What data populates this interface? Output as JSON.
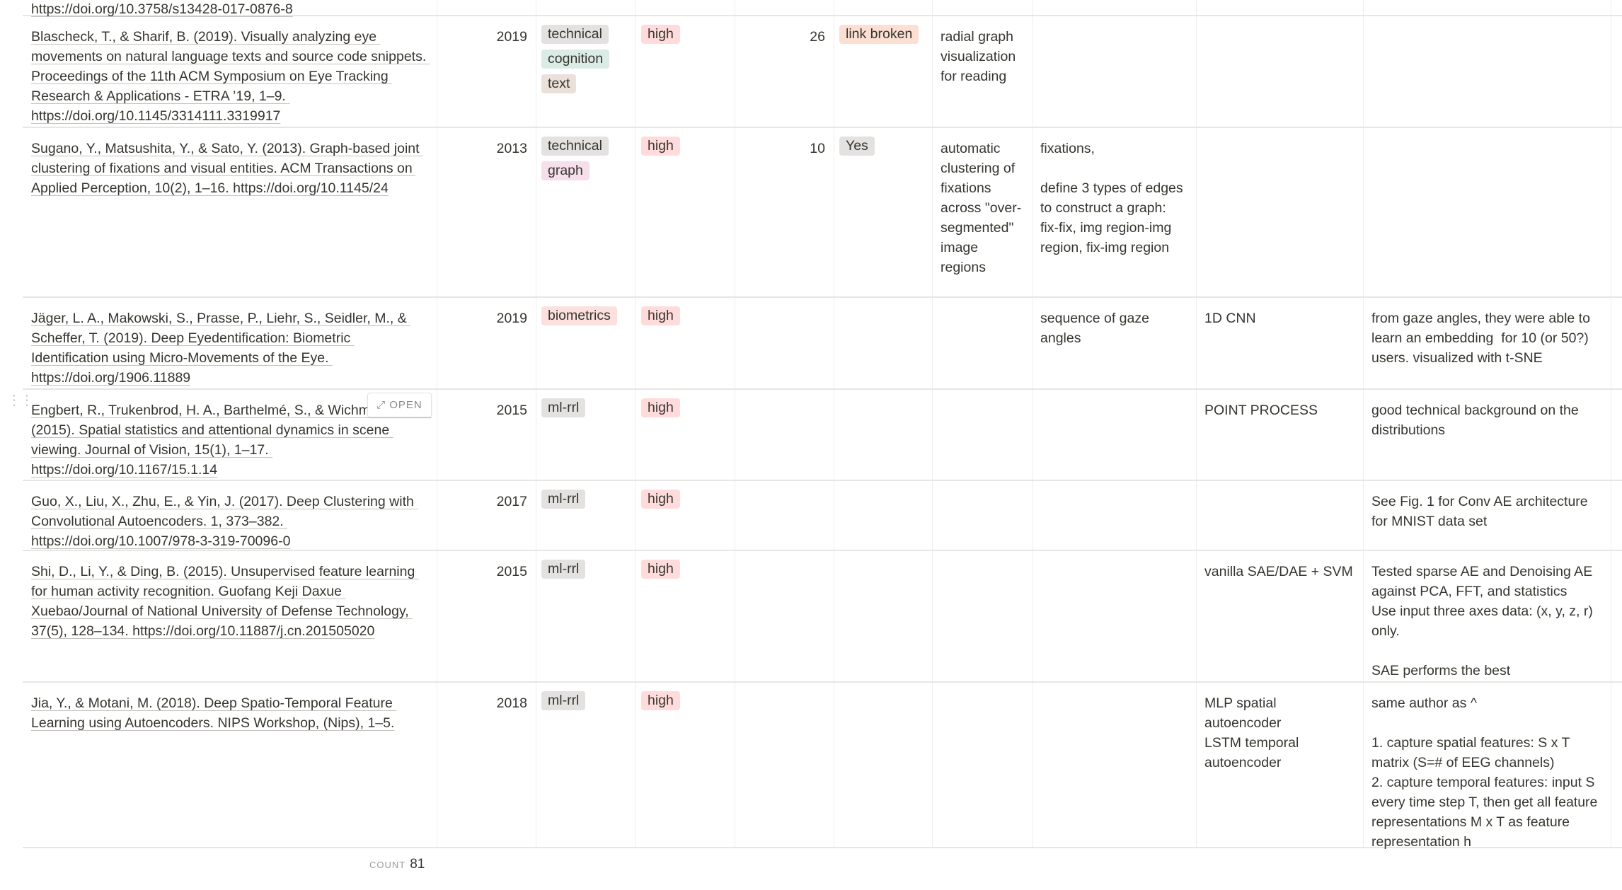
{
  "tag_colors": {
    "technical": "#e3e2e0",
    "cognition": "#dbece7",
    "text": "#ece0da",
    "graph": "#f6dfeb",
    "biometrics": "#fbe0dd",
    "ml-rrl": "#e3e2e0",
    "high": "#ffdcdb",
    "link broken": "#fbdfd2",
    "Yes": "#e3e2e0"
  },
  "rows": [
    {
      "citation": "https://doi.org/10.3758/s13428-017-0876-8",
      "year": "",
      "tags": [],
      "priority": "",
      "number": "",
      "status": "",
      "description": "",
      "data": "",
      "model": "",
      "notes": ""
    },
    {
      "citation": "Blascheck, T., & Sharif, B. (2019). Visually analyzing eye movements on natural language texts and source code snippets. Proceedings of the 11th ACM Symposium on Eye Tracking Research & Applications - ETRA ’19, 1–9. https://doi.org/10.1145/3314111.3319917",
      "year": "2019",
      "tags": [
        "technical",
        "cognition",
        "text"
      ],
      "priority": "high",
      "number": "26",
      "status": "link broken",
      "description": "radial graph visualization for reading",
      "data": "",
      "model": "",
      "notes": ""
    },
    {
      "citation": "Sugano, Y., Matsushita, Y., & Sato, Y. (2013). Graph-based joint clustering of fixations and visual entities. ACM Transactions on Applied Perception, 10(2), 1–16. https://doi.org/10.1145/24",
      "year": "2013",
      "tags": [
        "technical",
        "graph"
      ],
      "priority": "high",
      "number": "10",
      "status": "Yes",
      "description": "automatic clustering of fixations across \"over-segmented\" image regions",
      "data": "fixations,\n\ndefine 3 types of edges to construct a graph: fix-fix, img region-img region, fix-img region",
      "model": "",
      "notes": ""
    },
    {
      "citation": "Jäger, L. A., Makowski, S., Prasse, P., Liehr, S., Seidler, M., & Scheffer, T. (2019). Deep Eyedentification: Biometric Identification using Micro-Movements of the Eye. https://doi.org/1906.11889",
      "year": "2019",
      "tags": [
        "biometrics"
      ],
      "priority": "high",
      "number": "",
      "status": "",
      "description": "",
      "data": "sequence of gaze angles",
      "model": "1D CNN",
      "notes": "from gaze angles, they were able to learn an embedding  for 10 (or 50?) users. visualized with t-SNE"
    },
    {
      "citation": "Engbert, R., Trukenbrod, H. A., Barthelmé, S., & Wichmann, F. A. (2015). Spatial statistics and attentional dynamics in scene viewing. Journal of Vision, 15(1), 1–17. https://doi.org/10.1167/15.1.14",
      "year": "2015",
      "tags": [
        "ml-rrl"
      ],
      "priority": "high",
      "number": "",
      "status": "",
      "description": "",
      "data": "",
      "model": "POINT PROCESS",
      "notes": "good technical background on the distributions"
    },
    {
      "citation": "Guo, X., Liu, X., Zhu, E., & Yin, J. (2017). Deep Clustering with Convolutional Autoencoders. 1, 373–382. https://doi.org/10.1007/978-3-319-70096-0",
      "year": "2017",
      "tags": [
        "ml-rrl"
      ],
      "priority": "high",
      "number": "",
      "status": "",
      "description": "",
      "data": "",
      "model": "",
      "notes": "See Fig. 1 for Conv AE architecture for MNIST data set"
    },
    {
      "citation": "Shi, D., Li, Y., & Ding, B. (2015). Unsupervised feature learning for human activity recognition. Guofang Keji Daxue Xuebao/Journal of National University of Defense Technology, 37(5), 128–134. https://doi.org/10.11887/j.cn.201505020",
      "year": "2015",
      "tags": [
        "ml-rrl"
      ],
      "priority": "high",
      "number": "",
      "status": "",
      "description": "",
      "data": "",
      "model": "vanilla SAE/DAE + SVM",
      "notes": "Tested sparse AE and Denoising AE against PCA, FFT, and statistics\nUse input three axes data: (x, y, z, r) only.\n\nSAE performs the best"
    },
    {
      "citation": "Jia, Y., & Motani, M. (2018). Deep Spatio-Temporal Feature Learning using Autoencoders. NIPS Workshop, (Nips), 1–5.",
      "year": "2018",
      "tags": [
        "ml-rrl"
      ],
      "priority": "high",
      "number": "",
      "status": "",
      "description": "",
      "data": "",
      "model": "MLP spatial autoencoder\nLSTM temporal autoencoder",
      "notes": "same author as ^\n\n1. capture spatial features: S x T matrix (S=# of EEG channels)\n2. capture temporal features: input S every time step T, then get all feature representations M x T as feature representation h"
    }
  ],
  "hover_open_label": "OPEN",
  "footer": {
    "count_label": "COUNT",
    "count_value": "81"
  }
}
